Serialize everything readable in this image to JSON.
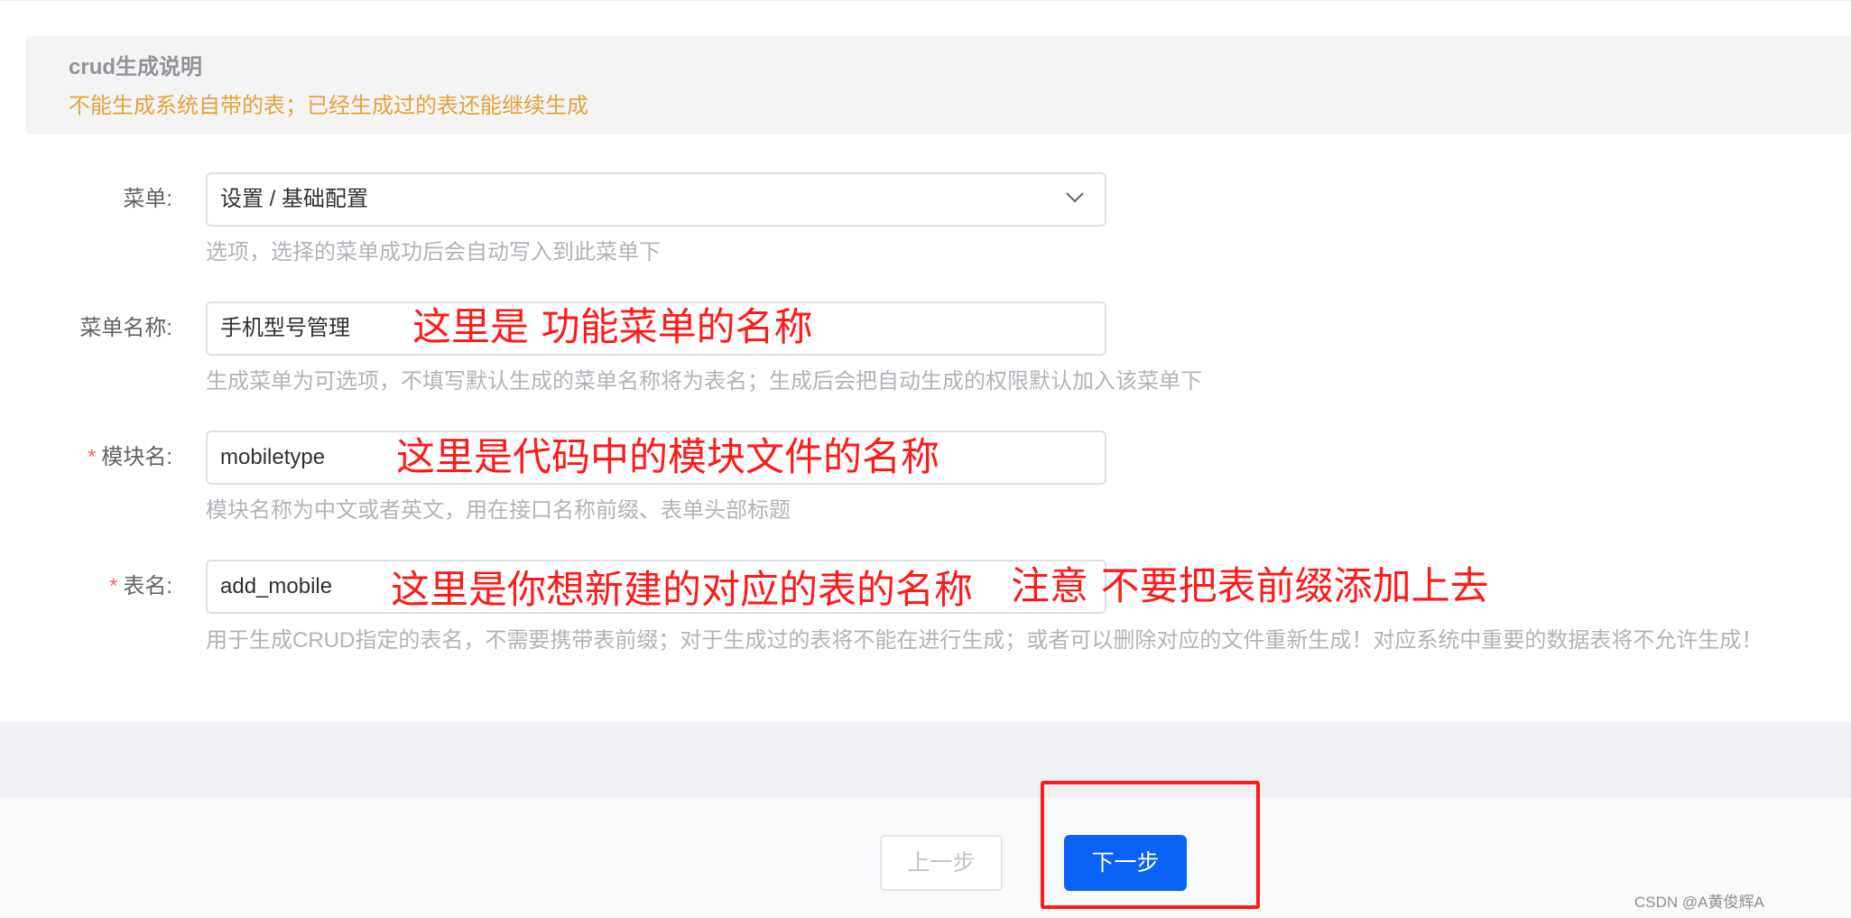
{
  "notice": {
    "title": "crud生成说明",
    "description": "不能生成系统自带的表；已经生成过的表还能继续生成"
  },
  "form": {
    "menu": {
      "label": "菜单:",
      "value": "设置 / 基础配置",
      "hint": "选项，选择的菜单成功后会自动写入到此菜单下"
    },
    "menu_name": {
      "label": "菜单名称:",
      "value": "手机型号管理",
      "hint": "生成菜单为可选项，不填写默认生成的菜单名称将为表名；生成后会把自动生成的权限默认加入该菜单下"
    },
    "module_name": {
      "required_mark": "*",
      "label": "模块名:",
      "value": "mobiletype",
      "hint": "模块名称为中文或者英文，用在接口名称前缀、表单头部标题"
    },
    "table_name": {
      "required_mark": "*",
      "label": "表名:",
      "value": "add_mobile",
      "hint": "用于生成CRUD指定的表名，不需要携带表前缀；对于生成过的表将不能在进行生成；或者可以删除对应的文件重新生成！对应系统中重要的数据表将不允许生成！"
    }
  },
  "annotations": {
    "menu_name": "这里是 功能菜单的名称",
    "module_name": "这里是代码中的模块文件的名称",
    "table_name": "这里是你想新建的对应的表的名称",
    "table_note": "注意 不要把表前缀添加上去"
  },
  "buttons": {
    "prev": "上一步",
    "next": "下一步"
  },
  "watermark": "CSDN @A黄俊辉A",
  "colors": {
    "primary": "#0b63f6",
    "warning": "#e6a23c",
    "annotation": "#ff1a1a",
    "required": "#f56c6c"
  },
  "icons": {
    "select_arrow": "chevron-down-icon"
  }
}
